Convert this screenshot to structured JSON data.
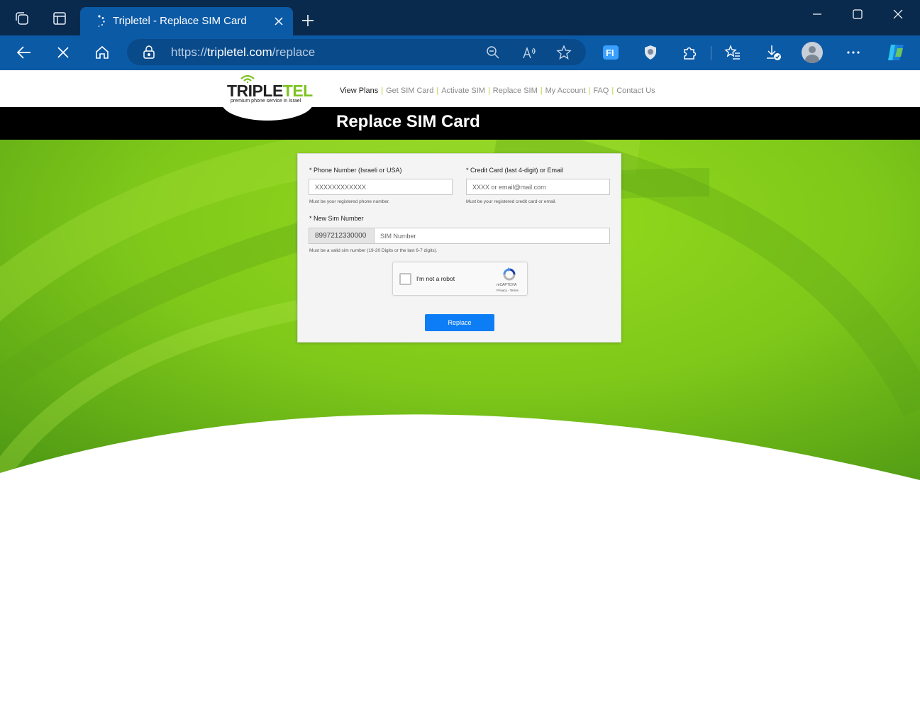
{
  "browser": {
    "tab": {
      "title": "Tripletel - Replace SIM Card"
    },
    "address": {
      "scheme": "https://",
      "host": "tripletel.com",
      "path": "/replace"
    },
    "icons": {
      "workspaces": "workspaces-icon",
      "tab_actions": "tab-actions-icon",
      "loading": "loading-spinner-icon",
      "close_tab": "close-icon",
      "new_tab": "plus-icon",
      "minimize": "minimize-icon",
      "maximize": "maximize-icon",
      "close_window": "close-icon",
      "back": "back-arrow-icon",
      "stop": "stop-icon",
      "home": "home-icon",
      "lock": "lock-icon",
      "zoom": "zoom-icon",
      "read_aloud": "read-aloud-icon",
      "favorite": "star-icon",
      "extension_fi": "fi-extension-icon",
      "shield": "shield-icon",
      "extensions": "puzzle-icon",
      "favorites": "favorites-icon",
      "downloads": "download-icon",
      "profile": "avatar-icon",
      "more": "more-icon",
      "copilot": "copilot-icon"
    }
  },
  "site": {
    "logo": {
      "name_dark": "TRIPLE",
      "name_green": "TEL",
      "tagline": "premium phone service in Israel"
    },
    "nav": [
      {
        "label": "View Plans",
        "active": true
      },
      {
        "label": "Get SIM Card",
        "active": false
      },
      {
        "label": "Activate SIM",
        "active": false
      },
      {
        "label": "Replace SIM",
        "active": false
      },
      {
        "label": "My Account",
        "active": false
      },
      {
        "label": "FAQ",
        "active": false
      },
      {
        "label": "Contact Us",
        "active": false
      }
    ],
    "page_title": "Replace SIM Card",
    "colors": {
      "accent_green": "#7cc31e",
      "nav_separator": "#b2d235",
      "button_blue": "#0d7df5",
      "title_bar": "#000000"
    }
  },
  "form": {
    "phone": {
      "label": "* Phone Number (Israeli or USA)",
      "placeholder": "XXXXXXXXXXXX",
      "help": "Must be your registered phone number."
    },
    "credit": {
      "label": "* Credit Card (last 4-digit) or Email",
      "placeholder": "XXXX or email@mail.com",
      "help": "Must be your registered credit card or email."
    },
    "sim": {
      "label": "* New Sim Number",
      "prefix": "8997212330000",
      "placeholder": "SIM Number",
      "help": "Must be a valid sim number (19-20 Digits or the last 6-7 digits)."
    },
    "captcha": {
      "label": "I'm not a robot",
      "brand": "reCAPTCHA",
      "links": "Privacy - Terms"
    },
    "submit": "Replace"
  }
}
